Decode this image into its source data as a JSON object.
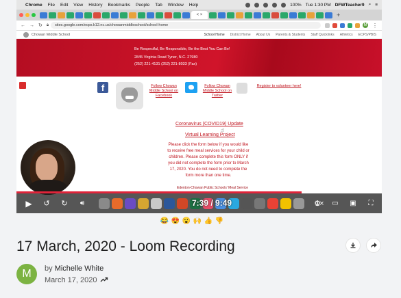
{
  "menubar": {
    "items": [
      "Chrome",
      "File",
      "Edit",
      "View",
      "History",
      "Bookmarks",
      "People",
      "Tab",
      "Window",
      "Help"
    ],
    "battery": "100%",
    "clock": "Tue 1:30 PM",
    "user": "DFWTeacher9"
  },
  "browser": {
    "url": "sites.google.com/ecps.k12.nc.us/chowanmiddleschool/school-home",
    "profile_initial": "M",
    "active_tab_label": "< ×"
  },
  "site": {
    "brand": "Chowan Middle School",
    "nav": [
      "School Home",
      "District Home",
      "About Us",
      "Parents & Students",
      "Staff Quicklinks",
      "Athletics",
      "ECPS/PBIS"
    ],
    "banner": {
      "motto": "Be Respectful, Be Responsible, Be the Best You Can Be!",
      "address": "2845 Virginia Road Tyner, N.C. 27980",
      "phones": "(252) 221-4131     (252) 221-8033 (Fax)"
    },
    "facebook_link": "Follow Chowan Middle School on Facebook",
    "twitter_link": "Follow Chowan Middle School on Twitter",
    "volunteer_link": "Register to volunteer here!",
    "covid_link": "Coronavirus (COVID19) Update",
    "learning_link": "Virtual Learning Project",
    "notice": "Please click the form below if you would like to receive free meal services for your child or children. Please complete this form ONLY if you did not complete the form prior to March 17, 2020. You do not need to complete the form more than one time.",
    "footer_note": "Edenton-Chowan Public Schools' Meal Service"
  },
  "player": {
    "time": "7:39 / 9:49",
    "speed": "1×",
    "progress": 0.78
  },
  "reactions": [
    "😂",
    "😍",
    "😮",
    "🙌",
    "👍",
    "👎"
  ],
  "video": {
    "title": "17 March, 2020 - Loom Recording",
    "author_prefix": "by",
    "author": "Michelle White",
    "author_initial": "M",
    "date": "March 17, 2020"
  }
}
